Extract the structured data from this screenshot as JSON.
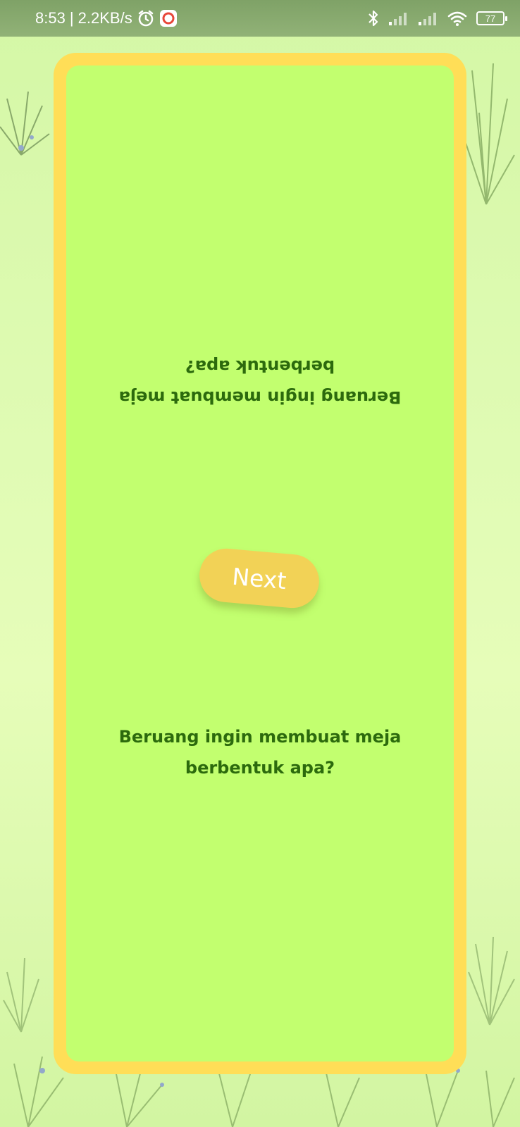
{
  "status_bar": {
    "time": "8:53",
    "network_speed": "| 2.2KB/s",
    "battery_level": "77",
    "icons": [
      "alarm-icon",
      "record-icon",
      "bluetooth-icon",
      "signal-icon",
      "signal-icon",
      "wifi-icon",
      "battery-icon"
    ]
  },
  "card": {
    "question_flipped": "Beruang ingin membuat meja berbentuk apa?",
    "question": "Beruang ingin membuat meja berbentuk apa?",
    "next_label": "Next"
  },
  "colors": {
    "card_border": "#ffde57",
    "card_fill": "#c2ff6f",
    "question_text": "#2c6a0d",
    "button": "#f2d256",
    "background": "#d9f9ab"
  }
}
